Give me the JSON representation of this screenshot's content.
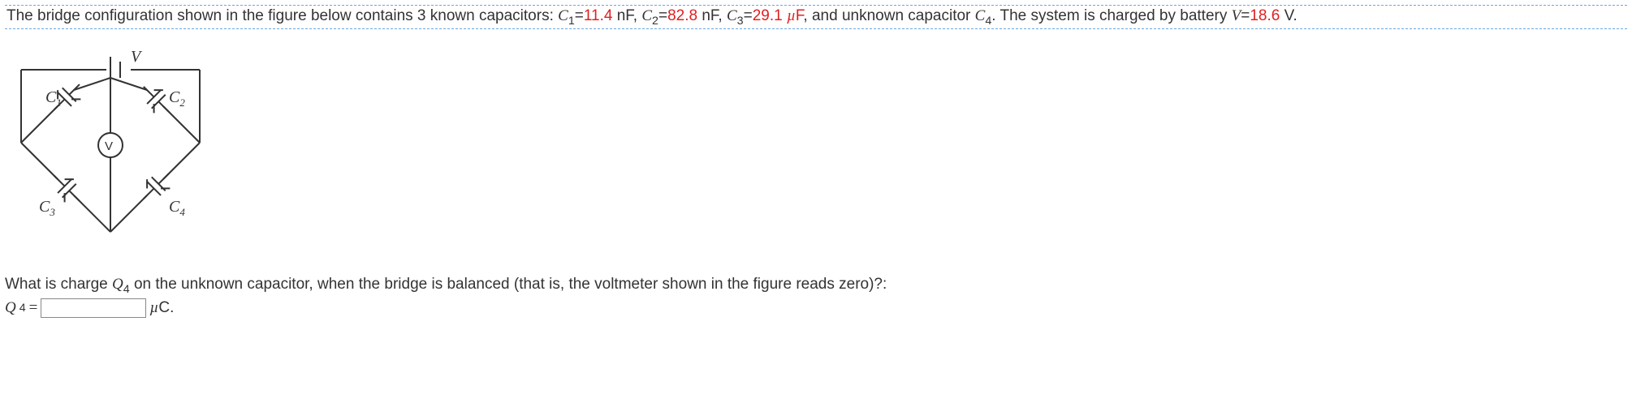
{
  "problem": {
    "intro_before": "The bridge configuration shown in the figure below contains 3 known capacitors: ",
    "C1_label": "C",
    "C1_sub": "1",
    "eq": "=",
    "C1_value": "11.4",
    "C1_unit": " nF, ",
    "C2_label": "C",
    "C2_sub": "2",
    "C2_value": "82.8",
    "C2_unit": " nF, ",
    "C3_label": "C",
    "C3_sub": "3",
    "C3_value": "29.1",
    "C3_unit_prefix": " ",
    "mu": "µ",
    "C3_unit": "F, and unknown capacitor ",
    "C4_label": "C",
    "C4_sub": "4",
    "after_c4": ". The system is charged by battery ",
    "V_label": "V",
    "V_value": "18.6",
    "V_unit": " V."
  },
  "circuit": {
    "labels": {
      "V": "V",
      "C1": "C",
      "C1s": "1",
      "C2": "C",
      "C2s": "2",
      "C3": "C",
      "C3s": "3",
      "C4": "C",
      "C4s": "4",
      "meter": "V"
    }
  },
  "question": {
    "text_before": "What is charge ",
    "Q_label": "Q",
    "Q_sub": "4",
    "text_after": " on the unknown capacitor, when the bridge is balanced (that is, the voltmeter shown in the figure reads zero)?:"
  },
  "answer": {
    "lhs_sym": "Q",
    "lhs_sub": "4",
    "equals": "=",
    "value": "",
    "unit_mu": "µ",
    "unit": "C."
  }
}
